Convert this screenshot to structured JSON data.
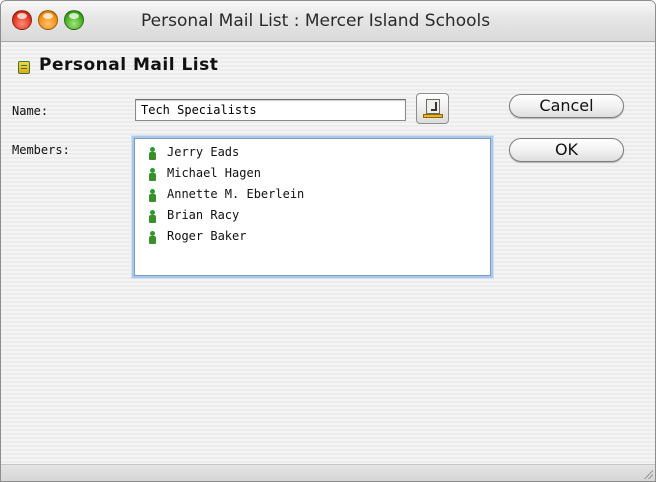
{
  "window": {
    "title": "Personal Mail List : Mercer Island Schools",
    "controls": [
      "close-icon",
      "minimize-icon",
      "zoom-icon"
    ]
  },
  "header": {
    "icon": "mail-list-icon",
    "title": "Personal Mail List"
  },
  "form": {
    "name_label": "Name:",
    "name_value": "Tech Specialists",
    "address_book_icon": "address-book-icon",
    "members_label": "Members:",
    "members": [
      {
        "name": "Jerry Eads",
        "icon": "person-icon"
      },
      {
        "name": "Michael Hagen",
        "icon": "person-icon"
      },
      {
        "name": "Annette M. Eberlein",
        "icon": "person-icon"
      },
      {
        "name": "Brian Racy",
        "icon": "person-icon"
      },
      {
        "name": "Roger Baker",
        "icon": "person-icon"
      }
    ]
  },
  "buttons": {
    "cancel_label": "Cancel",
    "ok_label": "OK"
  },
  "colors": {
    "person_icon": "#2b9b2f",
    "focus_ring": "#a9c8ea"
  }
}
